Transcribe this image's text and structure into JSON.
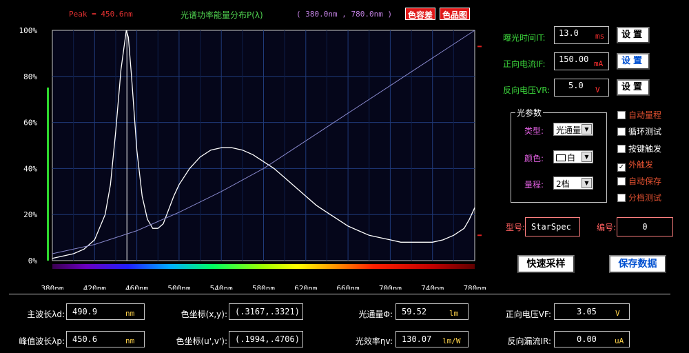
{
  "header": {
    "peak": "Peak = 450.6nm",
    "title": "光谱功率能量分布P(λ)",
    "range": "( 380.0nm , 780.0nm )",
    "btn_color_tolerance": "色容差",
    "btn_chromaticity": "色品图"
  },
  "chart_data": {
    "type": "line",
    "xlabel": "",
    "ylabel": "",
    "xlim": [
      380,
      780
    ],
    "ylim": [
      0,
      100
    ],
    "x_ticks": [
      "380nm",
      "420nm",
      "460nm",
      "500nm",
      "540nm",
      "580nm",
      "620nm",
      "660nm",
      "700nm",
      "740nm",
      "780nm"
    ],
    "y_ticks": [
      "0%",
      "20%",
      "40%",
      "60%",
      "80%",
      "100%"
    ],
    "grid": true,
    "peak_marker_nm": 450.6,
    "series": [
      {
        "color": "#ffffff",
        "x": [
          380,
          400,
          410,
          420,
          430,
          435,
          440,
          445,
          450,
          452,
          455,
          460,
          465,
          470,
          475,
          480,
          485,
          490,
          495,
          500,
          510,
          520,
          530,
          540,
          550,
          560,
          570,
          580,
          590,
          600,
          610,
          620,
          630,
          640,
          650,
          660,
          670,
          680,
          690,
          700,
          710,
          720,
          730,
          740,
          750,
          760,
          770,
          775,
          780
        ],
        "y": [
          1,
          3,
          5,
          9,
          20,
          33,
          56,
          83,
          100,
          97,
          80,
          48,
          28,
          18,
          14,
          14,
          16,
          22,
          28,
          33,
          40,
          45,
          48,
          49,
          49,
          48,
          46,
          43,
          40,
          36,
          32,
          28,
          24,
          21,
          18,
          15,
          13,
          11,
          10,
          9,
          8,
          8,
          8,
          8,
          9,
          11,
          14,
          18,
          23
        ]
      },
      {
        "color": "#8888cc",
        "x": [
          380,
          420,
          460,
          500,
          540,
          580,
          620,
          660,
          700,
          740,
          780
        ],
        "y": [
          3,
          7,
          13,
          21,
          30,
          40,
          52,
          64,
          76,
          88,
          100
        ]
      }
    ]
  },
  "controls": {
    "exposure_label": "曝光时间IT:",
    "exposure_value": "13.0",
    "exposure_unit": "ms",
    "forward_current_label": "正向电流IF:",
    "forward_current_value": "150.00",
    "forward_current_unit": "mA",
    "reverse_voltage_label": "反向电压VR:",
    "reverse_voltage_value": "5.0",
    "reverse_voltage_unit": "V",
    "set_label": "设置"
  },
  "optics": {
    "group_title": "光参数",
    "type_label": "类型:",
    "type_value": "光通量",
    "color_label": "颜色:",
    "color_value": "白",
    "range_label": "量程:",
    "range_value": "2档"
  },
  "checkboxes": [
    {
      "label": "自动量程",
      "checked": false,
      "color": "#e05030"
    },
    {
      "label": "循环测试",
      "checked": false,
      "color": "#ffffff"
    },
    {
      "label": "按键触发",
      "checked": false,
      "color": "#ffffff"
    },
    {
      "label": "外触发",
      "checked": true,
      "color": "#e05030"
    },
    {
      "label": "自动保存",
      "checked": false,
      "color": "#e05030"
    },
    {
      "label": "分档测试",
      "checked": false,
      "color": "#e05030"
    }
  ],
  "device": {
    "model_label": "型号:",
    "model_value": "StarSpec",
    "number_label": "编号:",
    "number_value": "0"
  },
  "actions": {
    "fast_sample": "快速采样",
    "save_data": "保存数据"
  },
  "results": {
    "dominant_wl_label": "主波长λd:",
    "dominant_wl_value": "490.9",
    "dominant_wl_unit": "nm",
    "peak_wl_label": "峰值波长λp:",
    "peak_wl_value": "450.6",
    "peak_wl_unit": "nm",
    "xy_label": "色坐标(x,y):",
    "xy_value": "(.3167,.3321)",
    "uv_label": "色坐标(u',v'):",
    "uv_value": "(.1994,.4706)",
    "flux_label": "光通量Φ:",
    "flux_value": "59.52",
    "flux_unit": "lm",
    "efficacy_label": "光效率ηv:",
    "efficacy_value": "130.07",
    "efficacy_unit": "lm/W",
    "vf_label": "正向电压VF:",
    "vf_value": "3.05",
    "vf_unit": "V",
    "ir_label": "反向漏流IR:",
    "ir_value": "0.00",
    "ir_unit": "uA"
  }
}
